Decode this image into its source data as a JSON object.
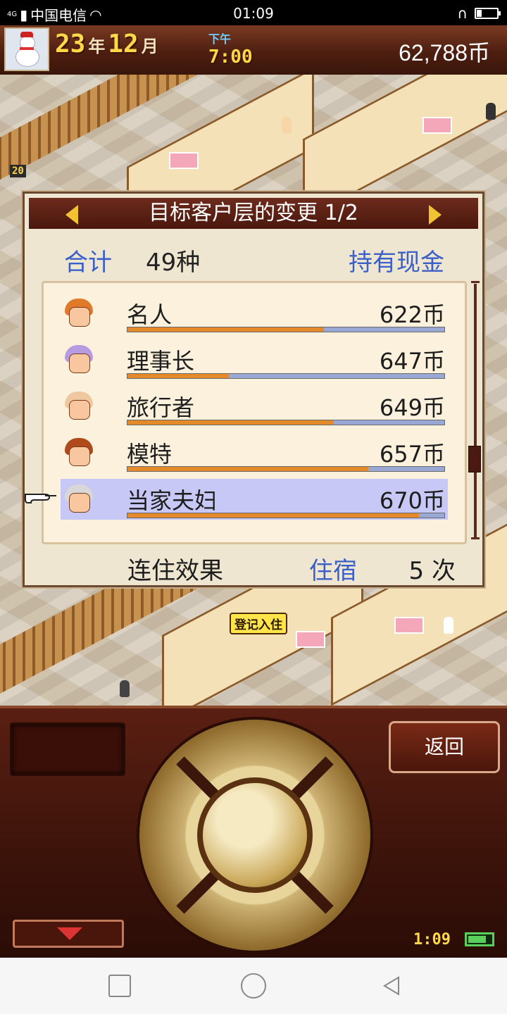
{
  "status_bar": {
    "network": "4G",
    "carrier": "中国电信",
    "clock": "01:09"
  },
  "hud": {
    "year": "23",
    "year_unit": "年",
    "month": "12",
    "month_unit": "月",
    "period": "下午",
    "time": "7:00",
    "money": "62,788币",
    "floor_badge": "20"
  },
  "scene": {
    "checkin_label": "登记入住"
  },
  "dialog": {
    "title": "目标客户层的变更 1/2",
    "total_label": "合计",
    "total_value": "49种",
    "cash_label": "持有现金",
    "rows": [
      {
        "name": "名人",
        "price": "622币",
        "bar": 0.62,
        "hair": "#e07a2a"
      },
      {
        "name": "理事长",
        "price": "647币",
        "bar": 0.32,
        "hair": "#b69be0"
      },
      {
        "name": "旅行者",
        "price": "649币",
        "bar": 0.65,
        "hair": "#f0c8a0"
      },
      {
        "name": "模特",
        "price": "657币",
        "bar": 0.76,
        "hair": "#b04a1a"
      },
      {
        "name": "当家夫妇",
        "price": "670币",
        "bar": 0.92,
        "hair": "#d8d8d8",
        "selected": true
      }
    ],
    "effect_label": "连住效果",
    "stay_label": "住宿",
    "stay_count": "5 次"
  },
  "panel": {
    "back_label": "返回",
    "clock": "1:09"
  }
}
